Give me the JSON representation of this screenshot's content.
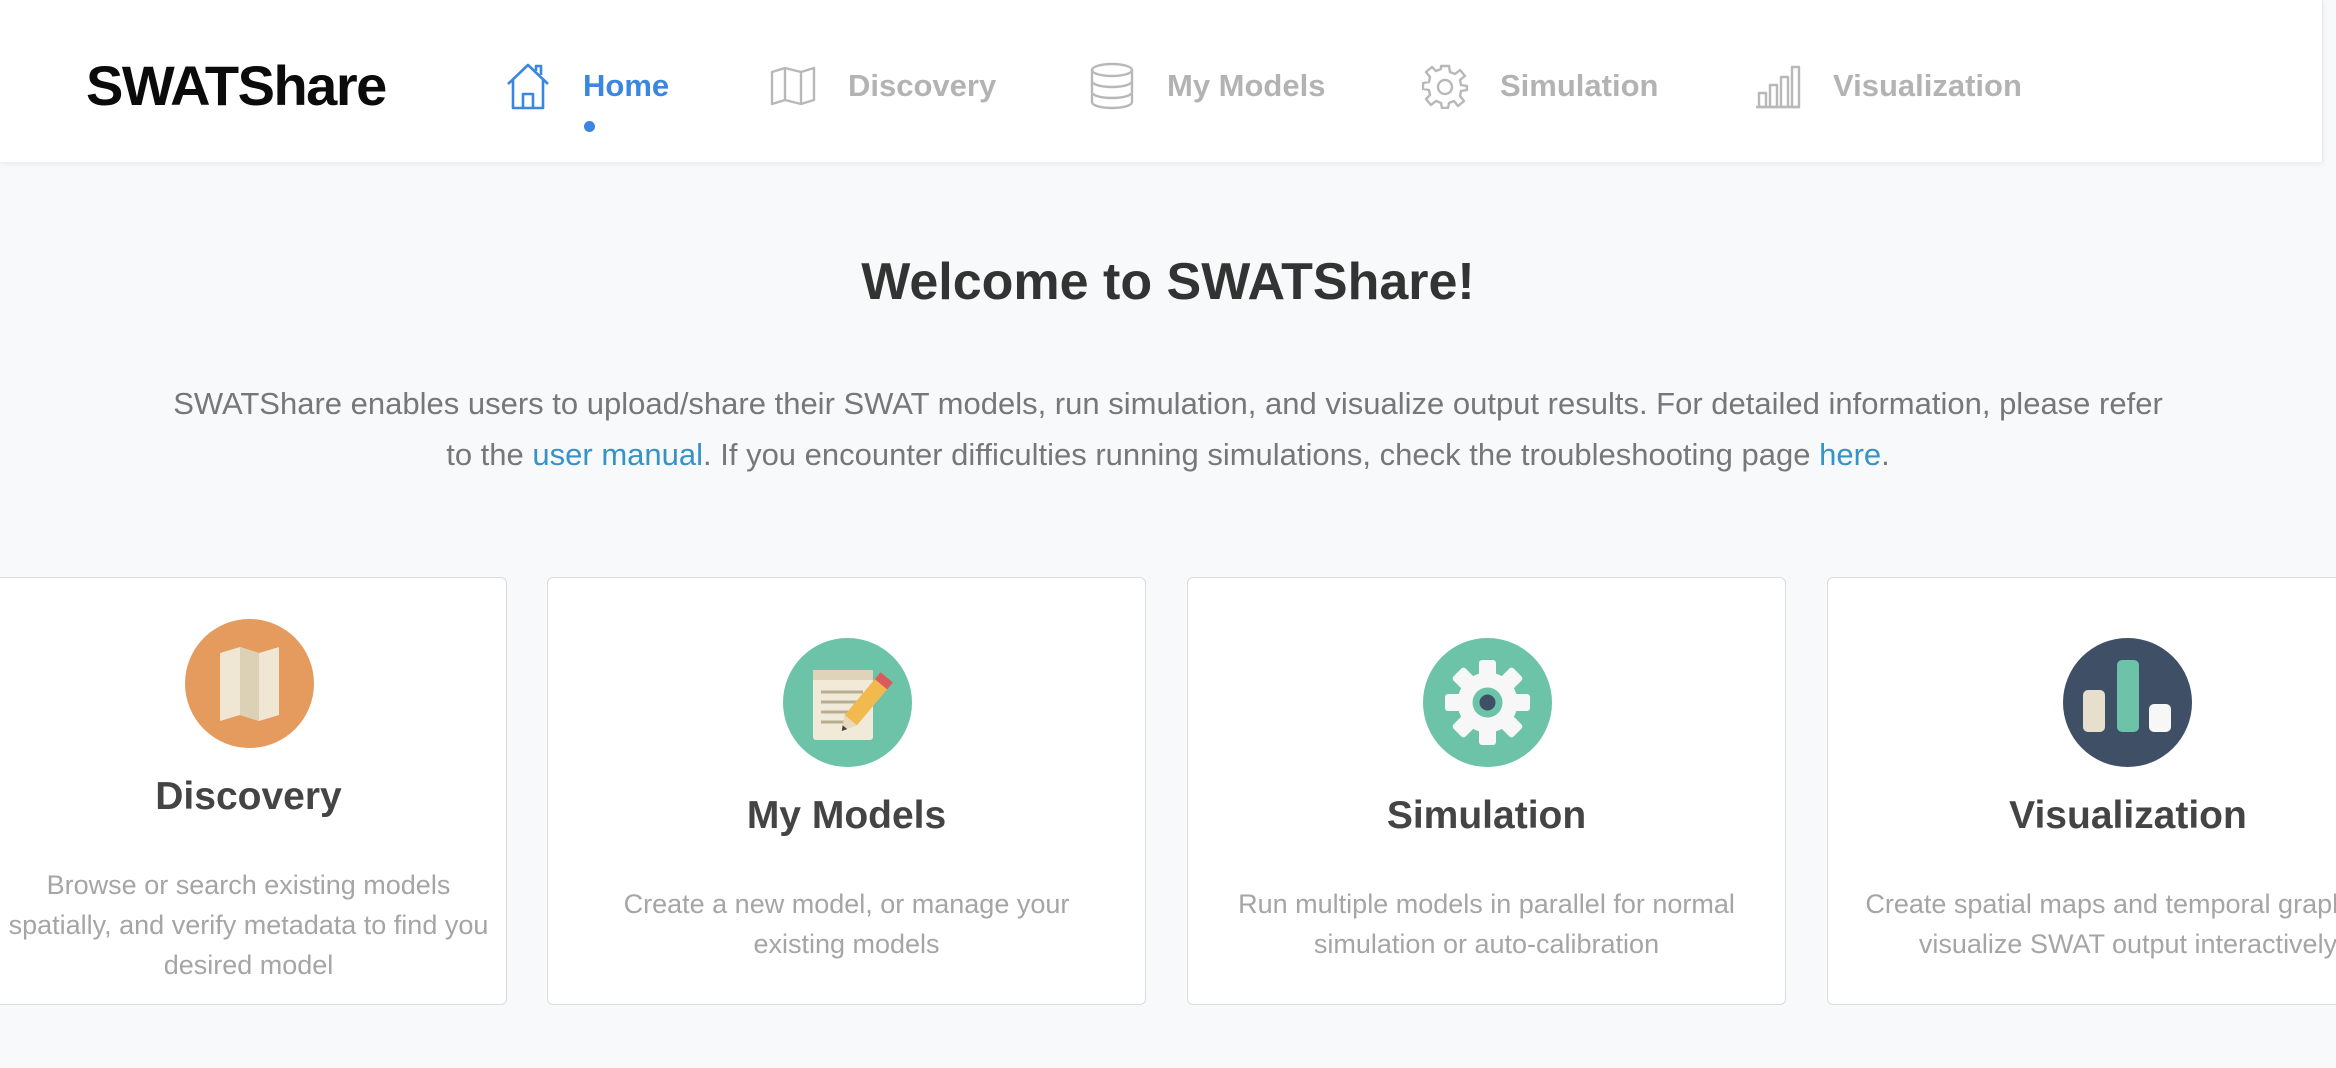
{
  "navbar": {
    "brand": "SWATShare",
    "items": [
      {
        "label": "Home",
        "icon": "home-icon",
        "active": true
      },
      {
        "label": "Discovery",
        "icon": "map-icon",
        "active": false
      },
      {
        "label": "My Models",
        "icon": "database-icon",
        "active": false
      },
      {
        "label": "Simulation",
        "icon": "gear-icon",
        "active": false
      },
      {
        "label": "Visualization",
        "icon": "bar-chart-icon",
        "active": false
      }
    ]
  },
  "welcome": {
    "title": "Welcome to SWATShare!",
    "intro_part1": "SWATShare enables users to upload/share their SWAT models, run simulation, and visualize output results. For detailed information, please refer to the ",
    "manual_link": "user manual",
    "intro_part2": ". If you encounter difficulties running simulations, check the troubleshooting page ",
    "here_link": "here",
    "intro_part3": "."
  },
  "cards": [
    {
      "title": "Discovery",
      "icon": "map-icon",
      "description": "Browse or search existing models spatially, and verify metadata to find you desired model"
    },
    {
      "title": "My Models",
      "icon": "notepad-pencil-icon",
      "description": "Create a new model, or manage your existing models"
    },
    {
      "title": "Simulation",
      "icon": "gear-icon",
      "description": "Run multiple models in parallel for normal simulation or auto-calibration"
    },
    {
      "title": "Visualization",
      "icon": "bar-chart-icon",
      "description": "Create spatial maps and temporal graphs to visualize SWAT output interactively"
    }
  ],
  "colors": {
    "accent": "#3b86e0",
    "link": "#3593c8",
    "nav_inactive": "#b3b3b3",
    "discovery_circle": "#e59a5e",
    "models_circle": "#6cc3a8",
    "simulation_circle": "#6cc3a8",
    "visualization_circle": "#3f4f66"
  }
}
